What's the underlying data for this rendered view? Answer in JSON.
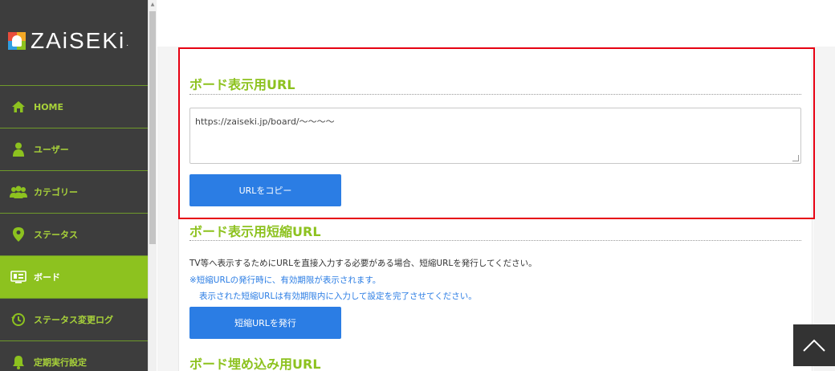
{
  "app": {
    "logo_text": "ZAiSEKi",
    "logo_mark": "."
  },
  "sidebar": {
    "items": [
      {
        "label": "HOME",
        "icon": "home-icon",
        "active": false
      },
      {
        "label": "ユーザー",
        "icon": "user-icon",
        "active": false
      },
      {
        "label": "カテゴリー",
        "icon": "users-group-icon",
        "active": false
      },
      {
        "label": "ステータス",
        "icon": "map-pin-icon",
        "active": false
      },
      {
        "label": "ボード",
        "icon": "board-icon",
        "active": true
      },
      {
        "label": "ステータス変更ログ",
        "icon": "history-icon",
        "active": false
      },
      {
        "label": "定期実行設定",
        "icon": "bell-icon",
        "active": false
      }
    ]
  },
  "board_url": {
    "title": "ボード表示用URL",
    "value": "https://zaiseki.jp/board/〜〜〜〜",
    "copy_button": "URLをコピー"
  },
  "short_url": {
    "title": "ボード表示用短縮URL",
    "description": "TV等へ表示するためにURLを直接入力する必要がある場合、短縮URLを発行してください。",
    "note_1": "※短縮URLの発行時に、有効期限が表示されます。",
    "note_2": "表示された短縮URLは有効期限内に入力して設定を完了させてください。",
    "issue_button": "短縮URLを発行"
  },
  "embed_url": {
    "title": "ボード埋め込み用URL"
  },
  "colors": {
    "accent_green": "#8dc21f",
    "sidebar_bg": "#3d3d3d",
    "button_blue": "#2b7de4",
    "highlight_red": "#e60012"
  }
}
